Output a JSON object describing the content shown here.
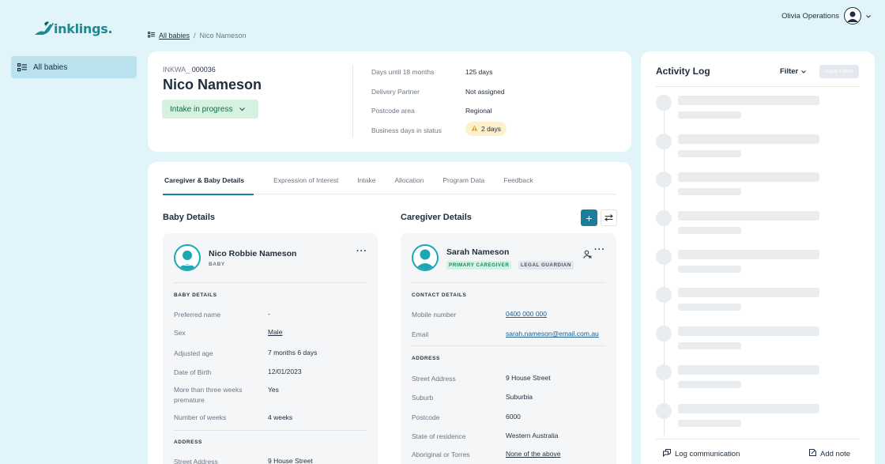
{
  "app": {
    "logo_text": "inklings."
  },
  "sidebar": {
    "items": [
      {
        "label": "All babies",
        "icon": "list-icon"
      }
    ]
  },
  "breadcrumb": {
    "root": "All babies",
    "separator": "/",
    "current": "Nico Nameson"
  },
  "user": {
    "name": "Olivia Operations"
  },
  "summary": {
    "id_prefix": "INKWA_",
    "id_number": "000036",
    "name": "Nico Nameson",
    "status": "Intake in progress",
    "fields": [
      {
        "label": "Days until 18 months",
        "value": "125 days"
      },
      {
        "label": "Delivery Partner",
        "value": "Not assigned"
      },
      {
        "label": "Postcode area",
        "value": "Regional"
      },
      {
        "label": "Business days in status",
        "value": "2 days"
      }
    ]
  },
  "tabs": [
    {
      "label": "Caregiver & Baby Details",
      "active": true
    },
    {
      "label": "Expression of Interest"
    },
    {
      "label": "Intake"
    },
    {
      "label": "Allocation"
    },
    {
      "label": "Program Data"
    },
    {
      "label": "Feedback"
    }
  ],
  "baby": {
    "section_title": "Baby Details",
    "name": "Nico Robbie Nameson",
    "role": "BABY",
    "details_caption": "BABY DETAILS",
    "fields": [
      {
        "label": "Preferred name",
        "value": "-"
      },
      {
        "label": "Sex",
        "value": "Male"
      },
      {
        "label": "Adjusted age",
        "value": "7 months 6 days"
      },
      {
        "label": "Date of Birth",
        "value": "12/01/2023"
      },
      {
        "label": "More than three weeks premature",
        "value": "Yes"
      },
      {
        "label": "Number of weeks",
        "value": "4 weeks"
      }
    ],
    "address_caption": "ADDRESS",
    "address_partial_label": "Street Address",
    "address_partial_value": "9 House Street"
  },
  "caregiver": {
    "section_title": "Caregiver Details",
    "name": "Sarah Nameson",
    "badges": [
      "PRIMARY CAREGIVER",
      "LEGAL GUARDIAN"
    ],
    "contact_caption": "CONTACT DETAILS",
    "contact": [
      {
        "label": "Mobile number",
        "value": "0400 000 000"
      },
      {
        "label": "Email",
        "value": "sarah.nameson@email.com.au"
      }
    ],
    "address_caption": "ADDRESS",
    "address": [
      {
        "label": "Street Address",
        "value": "9 House Street"
      },
      {
        "label": "Suburb",
        "value": "Suburbia"
      },
      {
        "label": "Postcode",
        "value": "6000"
      },
      {
        "label": "State of residence",
        "value": "Western Australia"
      },
      {
        "label": "Aboriginal or Torres",
        "value": "None of the above"
      }
    ]
  },
  "activity": {
    "title": "Activity Log",
    "filter_label": "Filter",
    "apply_label": "Apply Filters",
    "log_label": "Log communication",
    "note_label": "Add note"
  },
  "colors": {
    "accent": "#1d7e9a",
    "teal": "#1ba8b3",
    "background": "#e1f4fa"
  }
}
